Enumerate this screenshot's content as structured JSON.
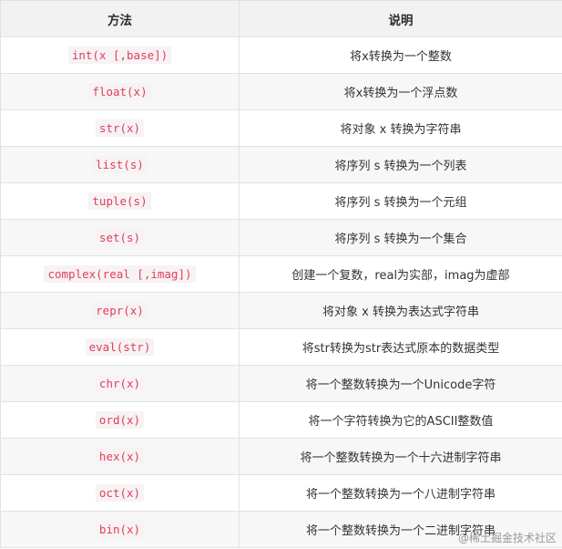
{
  "headers": [
    "方法",
    "说明"
  ],
  "rows": [
    {
      "method": "int(x [,base])",
      "desc": "将x转换为一个整数"
    },
    {
      "method": "float(x)",
      "desc": "将x转换为一个浮点数"
    },
    {
      "method": "str(x)",
      "desc": "将对象 x 转换为字符串"
    },
    {
      "method": "list(s)",
      "desc": "将序列 s 转换为一个列表"
    },
    {
      "method": "tuple(s)",
      "desc": "将序列 s 转换为一个元组"
    },
    {
      "method": "set(s)",
      "desc": "将序列 s 转换为一个集合"
    },
    {
      "method": "complex(real [,imag])",
      "desc": "创建一个复数，real为实部，imag为虚部"
    },
    {
      "method": "repr(x)",
      "desc": "将对象 x 转换为表达式字符串"
    },
    {
      "method": "eval(str)",
      "desc": "将str转换为str表达式原本的数据类型"
    },
    {
      "method": "chr(x)",
      "desc": "将一个整数转换为一个Unicode字符"
    },
    {
      "method": "ord(x)",
      "desc": "将一个字符转换为它的ASCII整数值"
    },
    {
      "method": "hex(x)",
      "desc": "将一个整数转换为一个十六进制字符串"
    },
    {
      "method": "oct(x)",
      "desc": "将一个整数转换为一个八进制字符串"
    },
    {
      "method": "bin(x)",
      "desc": "将一个整数转换为一个二进制字符串"
    }
  ],
  "watermark": "@稀土掘金技术社区",
  "colors": {
    "code_text": "#e03e5b",
    "code_bg": "#f7f2f4",
    "header_bg": "#f2f2f2",
    "stripe_bg": "#f7f7f7",
    "border": "#dfe2e5"
  }
}
